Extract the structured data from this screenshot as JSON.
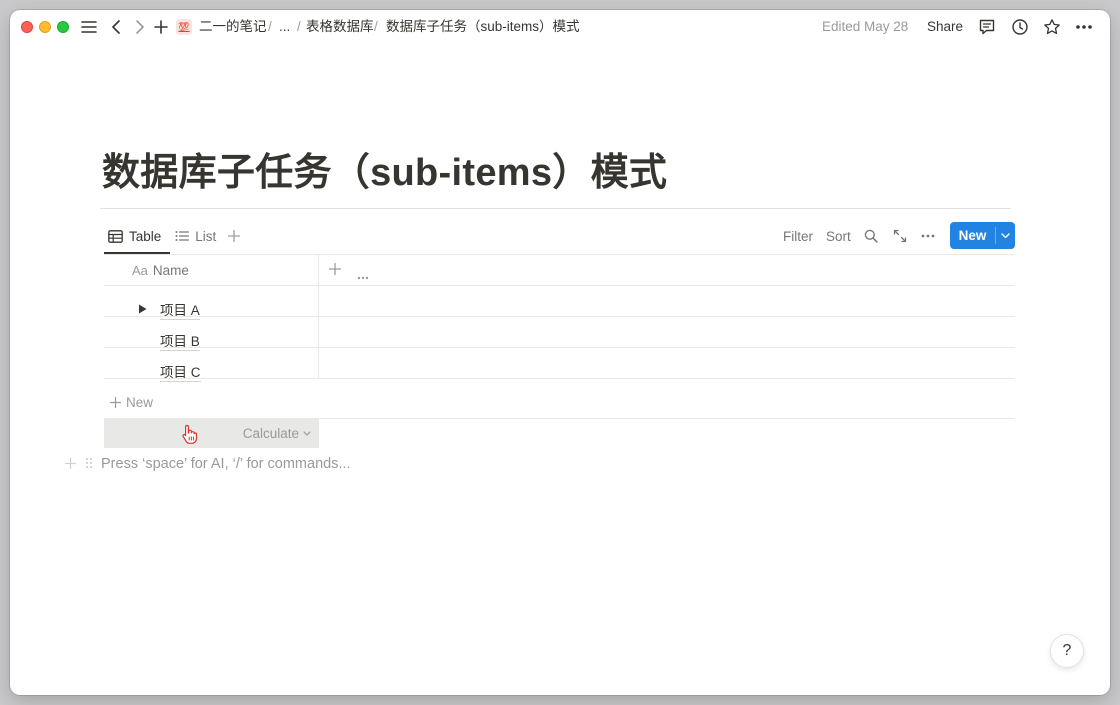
{
  "breadcrumb": {
    "emoji_label": "💯",
    "workspace": "二一的笔记",
    "ellipsis": "...",
    "parent": "表格数据库",
    "current": "数据库子任务（sub-items）模式",
    "sep": "/"
  },
  "topbar": {
    "edited": "Edited May 28",
    "share": "Share"
  },
  "page": {
    "title": "数据库子任务（sub-items）模式",
    "placeholder": "Press ‘space’ for AI, ‘/’ for commands..."
  },
  "views": {
    "tabs": [
      {
        "label": "Table",
        "active": true
      },
      {
        "label": "List",
        "active": false
      }
    ]
  },
  "toolbar": {
    "filter": "Filter",
    "sort": "Sort",
    "new_label": "New"
  },
  "table": {
    "header": {
      "name_prefix": "Aa",
      "name": "Name"
    },
    "rows": [
      {
        "name": "项目 A",
        "has_toggle": true
      },
      {
        "name": "项目 B",
        "has_toggle": false
      },
      {
        "name": "项目 C",
        "has_toggle": false
      }
    ],
    "new_row": "New",
    "calculate": "Calculate"
  },
  "help": "?",
  "colors": {
    "accent": "#2383e2",
    "text": "#37352f",
    "muted": "#9b9a97",
    "border": "#e9e9e7"
  }
}
